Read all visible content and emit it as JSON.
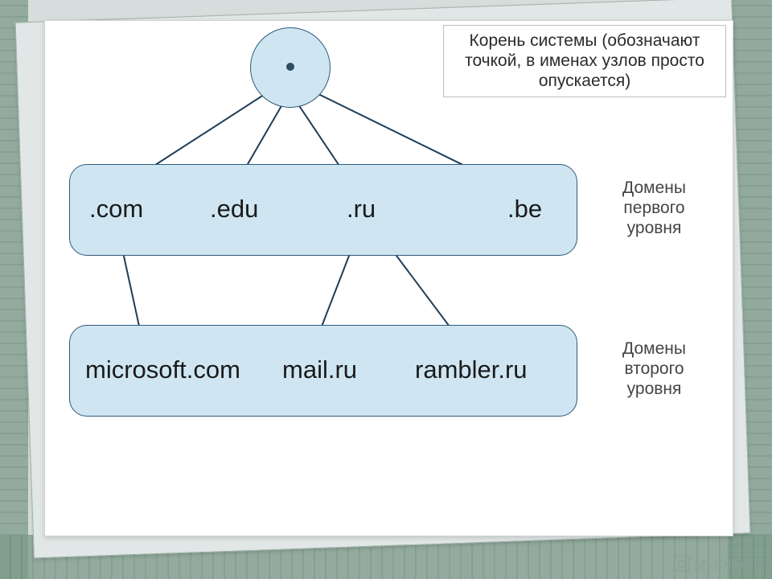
{
  "root_note": "Корень системы (обозначают точкой, в именах узлов просто опускается)",
  "level1_label": "Домены первого уровня",
  "level2_label": "Домены второго уровня",
  "tlds": {
    "com": ".com",
    "edu": ".edu",
    "ru": ".ru",
    "be": ".be"
  },
  "slds": {
    "microsoft": "microsoft.com",
    "mail": "mail.ru",
    "rambler": "rambler.ru"
  },
  "watermark": "MyShared",
  "colors": {
    "node_fill": "#cfe6f2",
    "node_stroke": "#2f5a7a",
    "line": "#1f3d57"
  }
}
